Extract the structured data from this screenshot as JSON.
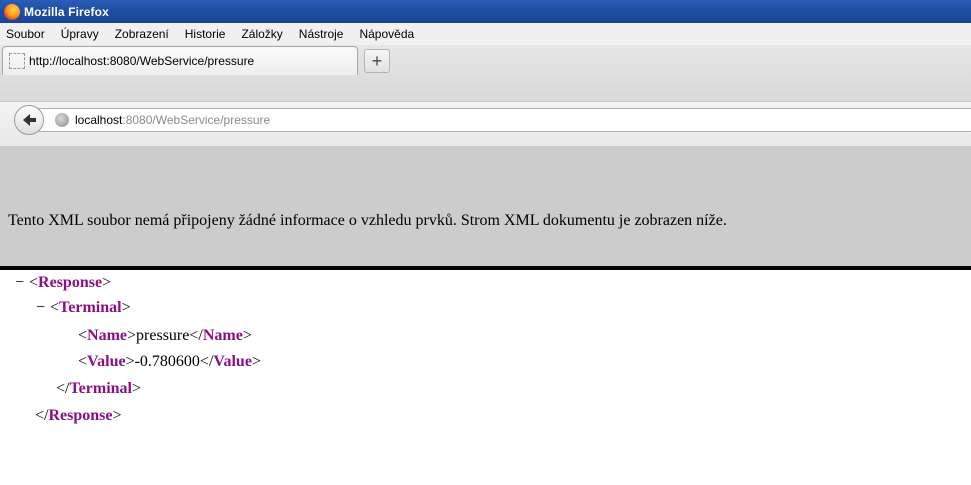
{
  "window": {
    "title": "Mozilla Firefox"
  },
  "menu": {
    "items": [
      "Soubor",
      "Úpravy",
      "Zobrazení",
      "Historie",
      "Záložky",
      "Nástroje",
      "Nápověda"
    ]
  },
  "tab": {
    "label": "http://localhost:8080/WebService/pressure",
    "new_tab_label": "+"
  },
  "navbar": {
    "url_host": "localhost",
    "url_rest": ":8080/WebService/pressure"
  },
  "xml_banner": {
    "text": "Tento XML soubor nemá připojeny žádné informace o vzhledu prvků. Strom XML dokumentu je zobrazen níže."
  },
  "xml": {
    "collapse_symbol": "−",
    "root_tag": "Response",
    "terminal_tag": "Terminal",
    "name_tag": "Name",
    "name_value": "pressure",
    "value_tag": "Value",
    "value_value": "-0.780600"
  },
  "icons": {
    "app": "firefox-logo-icon",
    "tab": "page-icon",
    "back": "back-arrow-icon",
    "site": "globe-icon"
  }
}
